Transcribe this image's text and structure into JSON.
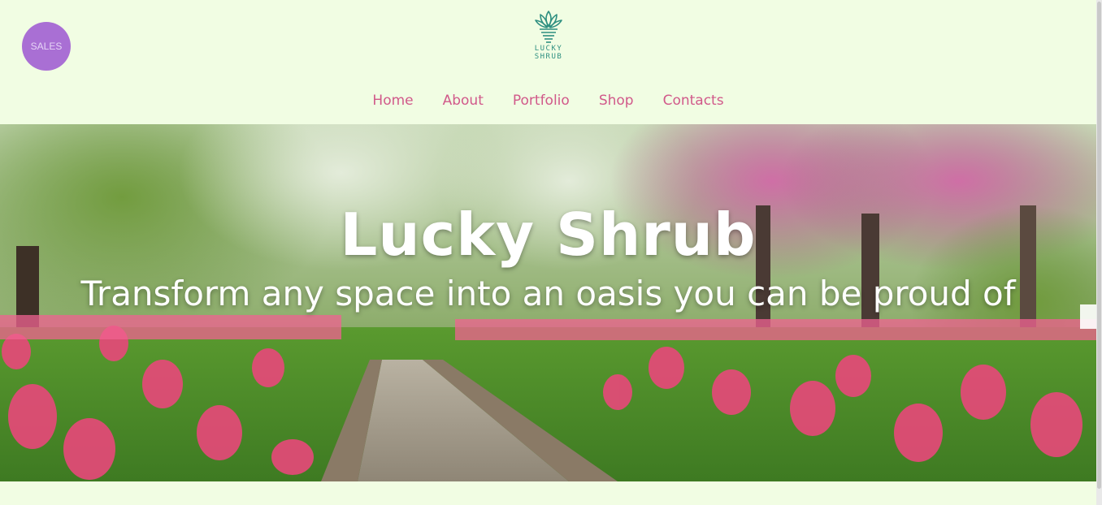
{
  "badge": {
    "label": "SALES"
  },
  "logo": {
    "line1": "LUCKY",
    "line2": "SHRUB",
    "icon": "plant-pot-icon"
  },
  "nav": {
    "items": [
      {
        "label": "Home"
      },
      {
        "label": "About"
      },
      {
        "label": "Portfolio"
      },
      {
        "label": "Shop"
      },
      {
        "label": "Contacts"
      }
    ]
  },
  "hero": {
    "title": "Lucky Shrub",
    "tagline": "Transform any space into an oasis you can be proud of",
    "image": "tulip-garden-path-photo"
  },
  "colors": {
    "background": "#f1fde3",
    "nav_link": "#d1598a",
    "badge": "#a96fd4",
    "logo": "#2e8f80"
  }
}
